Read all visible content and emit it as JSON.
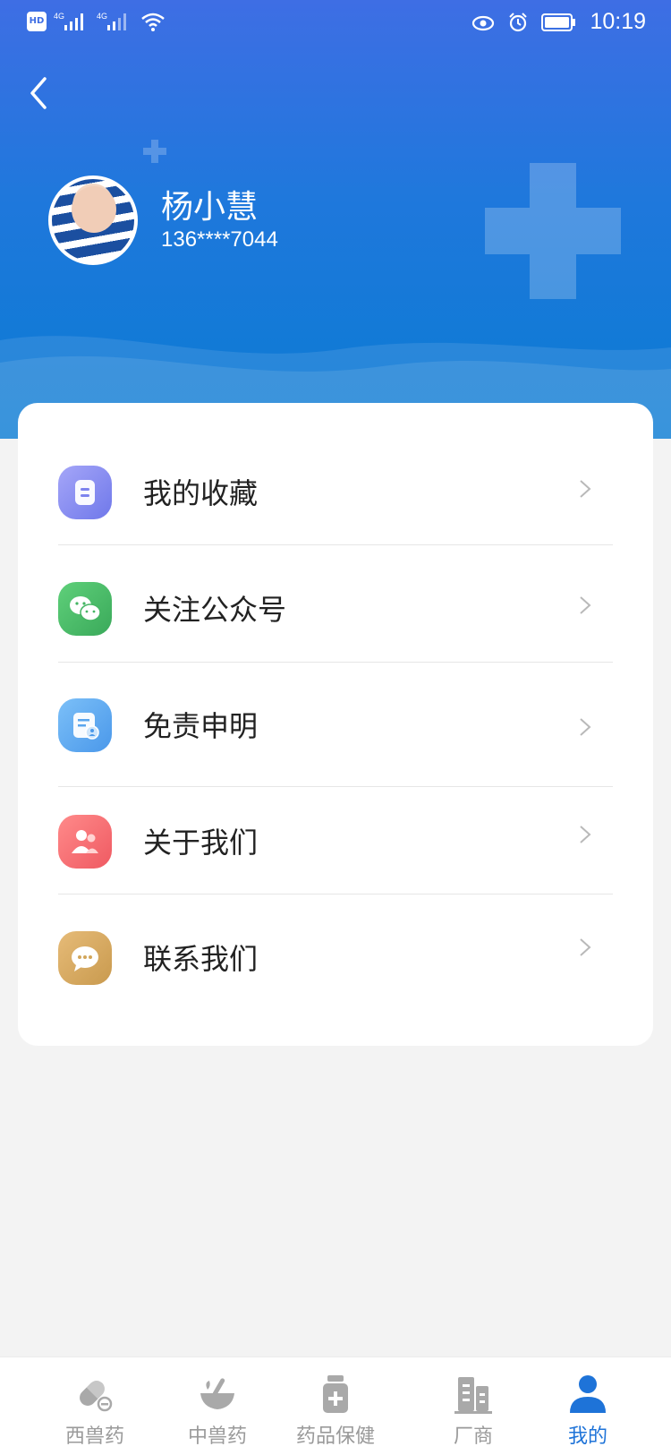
{
  "status_bar": {
    "network_labels": [
      "4G",
      "4G"
    ],
    "time": "10:19"
  },
  "profile": {
    "name": "杨小慧",
    "phone": "136****7044"
  },
  "menu": [
    {
      "label": "我的收藏",
      "icon": "collection-icon",
      "color": "#8b8ff2"
    },
    {
      "label": "关注公众号",
      "icon": "wechat-icon",
      "color": "#4fc36b"
    },
    {
      "label": "免责申明",
      "icon": "disclaimer-icon",
      "color": "#62aef2"
    },
    {
      "label": "关于我们",
      "icon": "about-us-icon",
      "color": "#f2656a"
    },
    {
      "label": "联系我们",
      "icon": "chat-icon",
      "color": "#d6a65a"
    }
  ],
  "tabs": [
    {
      "label": "西兽药",
      "icon": "capsule-icon",
      "active": false
    },
    {
      "label": "中兽药",
      "icon": "mortar-icon",
      "active": false
    },
    {
      "label": "药品保健",
      "icon": "medicine-bottle-icon",
      "active": false
    },
    {
      "label": "厂商",
      "icon": "building-icon",
      "active": false
    },
    {
      "label": "我的",
      "icon": "person-icon",
      "active": true
    }
  ],
  "colors": {
    "header_top": "#3e6ee4",
    "header_bottom": "#0a7bd3",
    "active_tab": "#1e73d8",
    "inactive_tab": "#9a9a9a"
  }
}
